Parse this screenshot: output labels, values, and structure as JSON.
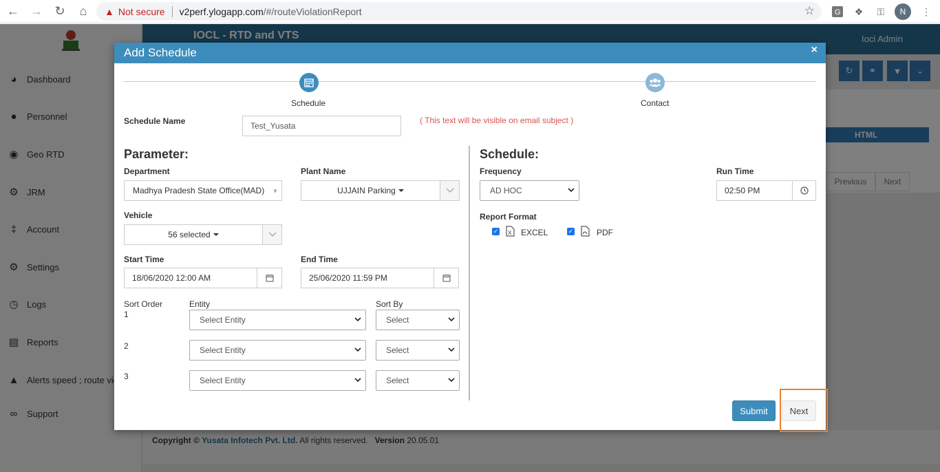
{
  "browser": {
    "security_label": "Not secure",
    "url_host": "v2perf.ylogapp.com",
    "url_path": "/#/routeViolationReport",
    "profile_initial": "N"
  },
  "app": {
    "title": "IOCL - RTD and VTS",
    "user_name": "Ioci Admin",
    "sidebar": [
      {
        "label": "Dashboard",
        "icon": "pie-chart-icon"
      },
      {
        "label": "Personnel",
        "icon": "users-icon"
      },
      {
        "label": "Geo RTD",
        "icon": "map-marker-icon"
      },
      {
        "label": "JRM",
        "icon": "gear-icon"
      },
      {
        "label": "Account",
        "icon": "thermometer-icon"
      },
      {
        "label": "Settings",
        "icon": "gear-icon"
      },
      {
        "label": "Logs",
        "icon": "clock-icon"
      },
      {
        "label": "Reports",
        "icon": "document-icon"
      },
      {
        "label": "Alerts speed ; route vic",
        "icon": "bell-icon"
      },
      {
        "label": "Support",
        "icon": "link-icon"
      }
    ],
    "table_header": "HTML",
    "pager_previous": "Previous",
    "pager_next": "Next",
    "footer_copyright": "Copyright ©",
    "footer_company": "Yusata Infotech Pvt. Ltd.",
    "footer_rights": "All rights reserved.",
    "footer_version_label": "Version",
    "footer_version": "20.05.01"
  },
  "modal": {
    "title": "Add Schedule",
    "close": "×",
    "steps": [
      {
        "label": "Schedule",
        "icon": "calendar-icon"
      },
      {
        "label": "Contact",
        "icon": "users-icon"
      }
    ],
    "schedule_name_label": "Schedule Name",
    "schedule_name_value": "Test_Yusata",
    "schedule_name_hint": "( This text will be visible on email subject )",
    "parameter": {
      "title": "Parameter:",
      "department_label": "Department",
      "department_value": "Madhya Pradesh State Office(MAD)",
      "plant_label": "Plant Name",
      "plant_value": "UJJAIN Parking",
      "vehicle_label": "Vehicle",
      "vehicle_value": "56 selected",
      "start_label": "Start Time",
      "start_value": "18/06/2020 12:00 AM",
      "end_label": "End Time",
      "end_value": "25/06/2020 11:59 PM",
      "sort_order_label": "Sort Order",
      "entity_label": "Entity",
      "sort_by_label": "Sort By",
      "sort_rows": [
        {
          "order": "1",
          "entity": "Select Entity",
          "sort_by": "Select"
        },
        {
          "order": "2",
          "entity": "Select Entity",
          "sort_by": "Select"
        },
        {
          "order": "3",
          "entity": "Select Entity",
          "sort_by": "Select"
        }
      ]
    },
    "schedule": {
      "title": "Schedule:",
      "frequency_label": "Frequency",
      "frequency_value": "AD HOC",
      "run_time_label": "Run Time",
      "run_time_value": "02:50 PM",
      "report_format_label": "Report Format",
      "formats": [
        {
          "label": "EXCEL",
          "checked": true,
          "icon": "excel-file-icon"
        },
        {
          "label": "PDF",
          "checked": true,
          "icon": "pdf-file-icon"
        }
      ]
    },
    "submit_label": "Submit",
    "next_label": "Next"
  },
  "colors": {
    "primary": "#3c8dbc",
    "header": "#2b6d93",
    "hint": "#d9534f",
    "highlight": "#e8812e"
  }
}
